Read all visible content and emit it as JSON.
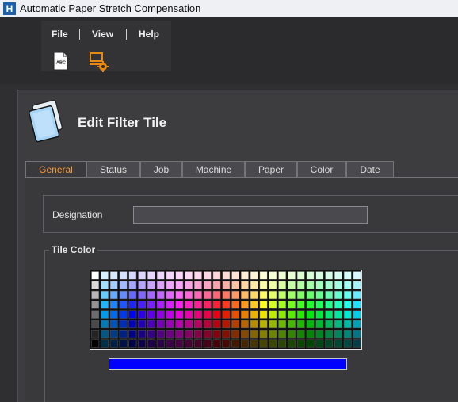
{
  "window": {
    "title": "Automatic Paper Stretch Compensation",
    "icon_letter": "H"
  },
  "menu": {
    "items": [
      "File",
      "View",
      "Help"
    ]
  },
  "toolbar": {
    "icons": [
      "spellcheck-document-icon",
      "machine-settings-icon"
    ]
  },
  "page": {
    "title": "Edit Filter Tile"
  },
  "tabs": [
    "General",
    "Status",
    "Job",
    "Machine",
    "Paper",
    "Color",
    "Date"
  ],
  "active_tab": "General",
  "form": {
    "designation_label": "Designation",
    "designation_value": "",
    "tile_color_group": "Tile Color"
  },
  "palette": {
    "columns": 29,
    "rows": 8
  },
  "selected_color": "#0000ff",
  "colors": {
    "accent_tab": "#f29a3a"
  }
}
